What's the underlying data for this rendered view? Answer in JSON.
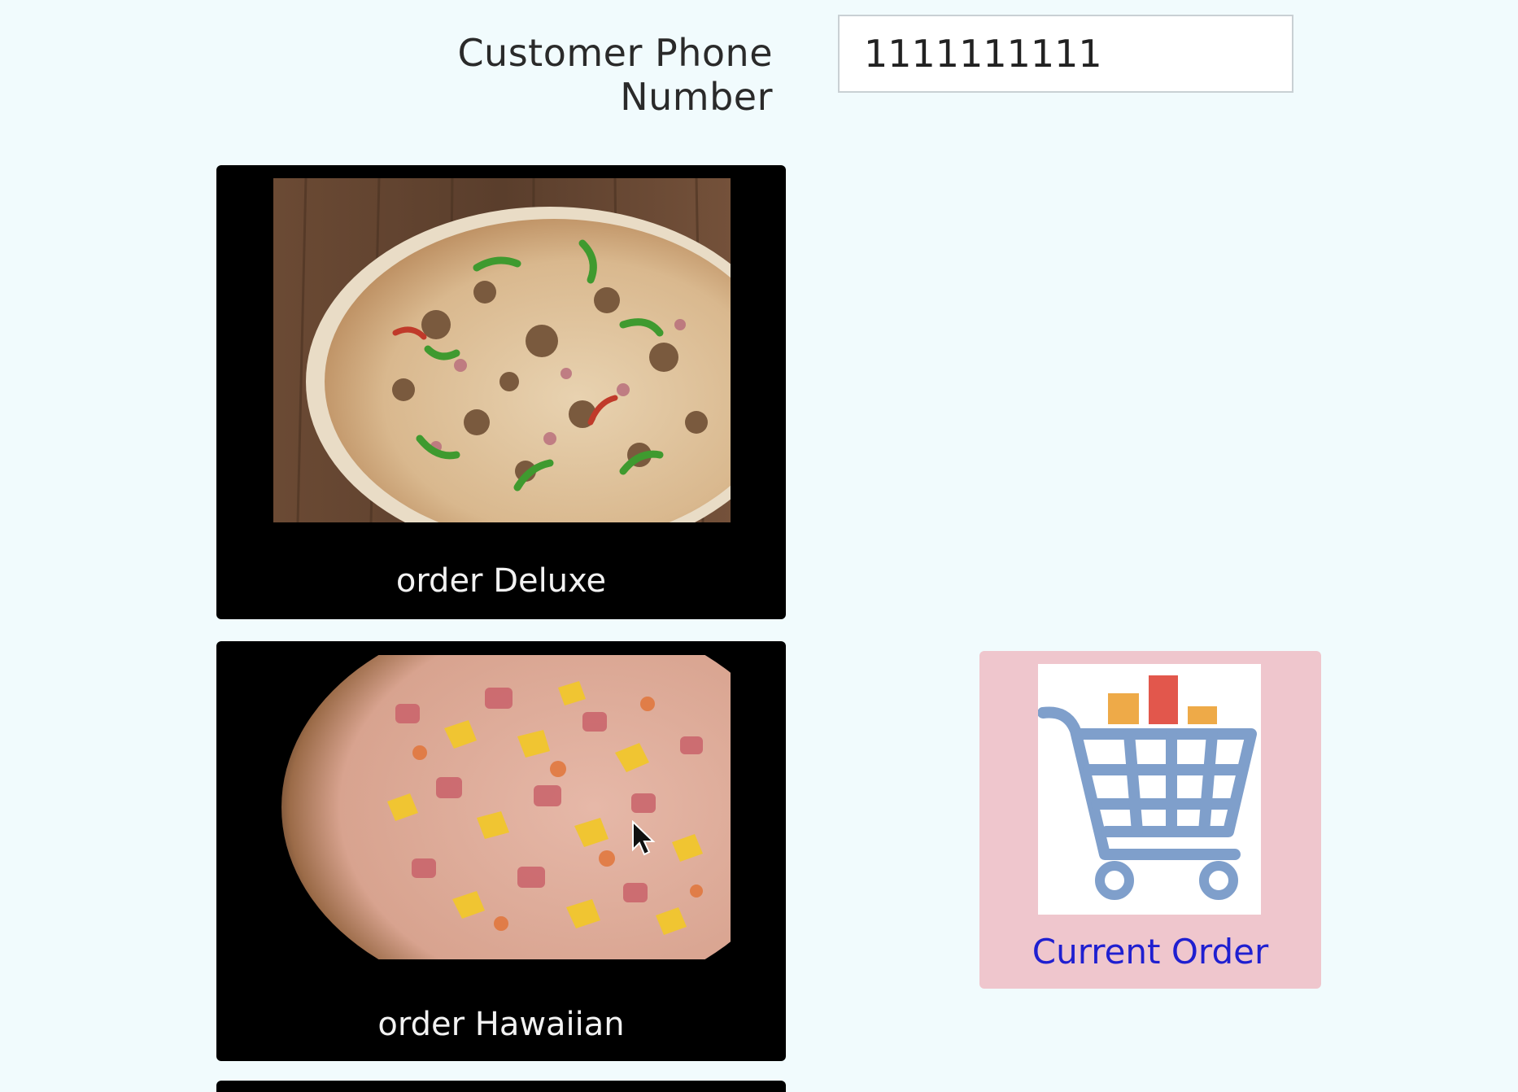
{
  "customer": {
    "phone_label": "Customer Phone Number",
    "phone_value": "1111111111"
  },
  "menu": {
    "items": [
      {
        "label": "order Deluxe"
      },
      {
        "label": "order Hawaiian"
      }
    ]
  },
  "current_order": {
    "label": "Current Order"
  },
  "colors": {
    "background": "#f1fbfd",
    "card_background": "#000000",
    "order_tile_background": "#efc6cd",
    "order_label": "#1f1fd0",
    "cart_icon": "#7f9fcb"
  }
}
